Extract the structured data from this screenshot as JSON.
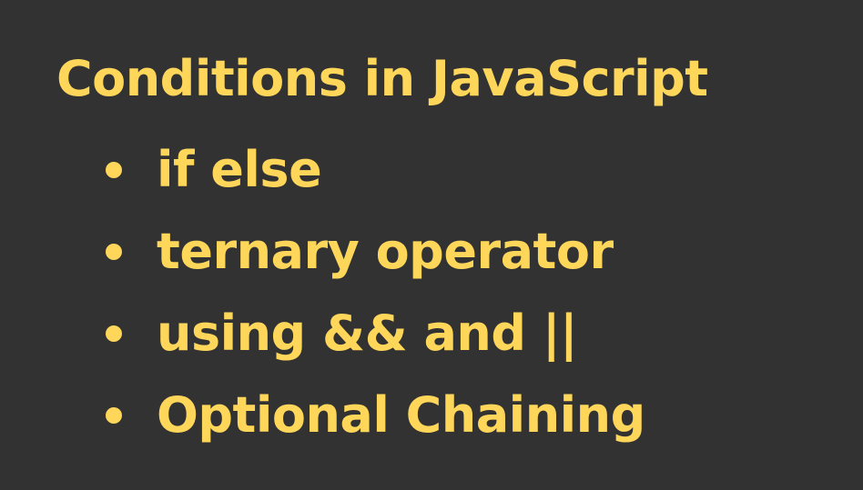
{
  "slide": {
    "title": "Conditions in JavaScript",
    "bullets": [
      "if else",
      "ternary operator",
      "using && and ||",
      "Optional Chaining"
    ]
  },
  "colors": {
    "background": "#323232",
    "text": "#FDD65A"
  }
}
